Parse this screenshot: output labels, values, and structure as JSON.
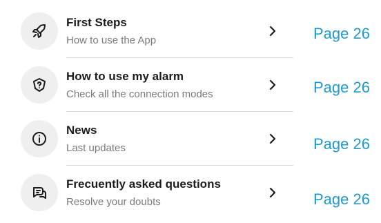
{
  "menu": {
    "items": [
      {
        "title": "First Steps",
        "subtitle": "How to use the App",
        "icon": "rocket-icon",
        "page": "Page 26"
      },
      {
        "title": "How to use my alarm",
        "subtitle": "Check all the connection modes",
        "icon": "question-shield-icon",
        "page": "Page 26"
      },
      {
        "title": "News",
        "subtitle": "Last updates",
        "icon": "info-icon",
        "page": "Page 26"
      },
      {
        "title": "Frecuently asked questions",
        "subtitle": "Resolve your doubts",
        "icon": "chat-bubbles-icon",
        "page": "Page 26"
      }
    ]
  },
  "colors": {
    "accent": "#1c9ad6",
    "title": "#1c1c1c",
    "subtitle": "#7b7b7b",
    "icon_bg": "#efefef",
    "divider": "#dcdcdc"
  }
}
